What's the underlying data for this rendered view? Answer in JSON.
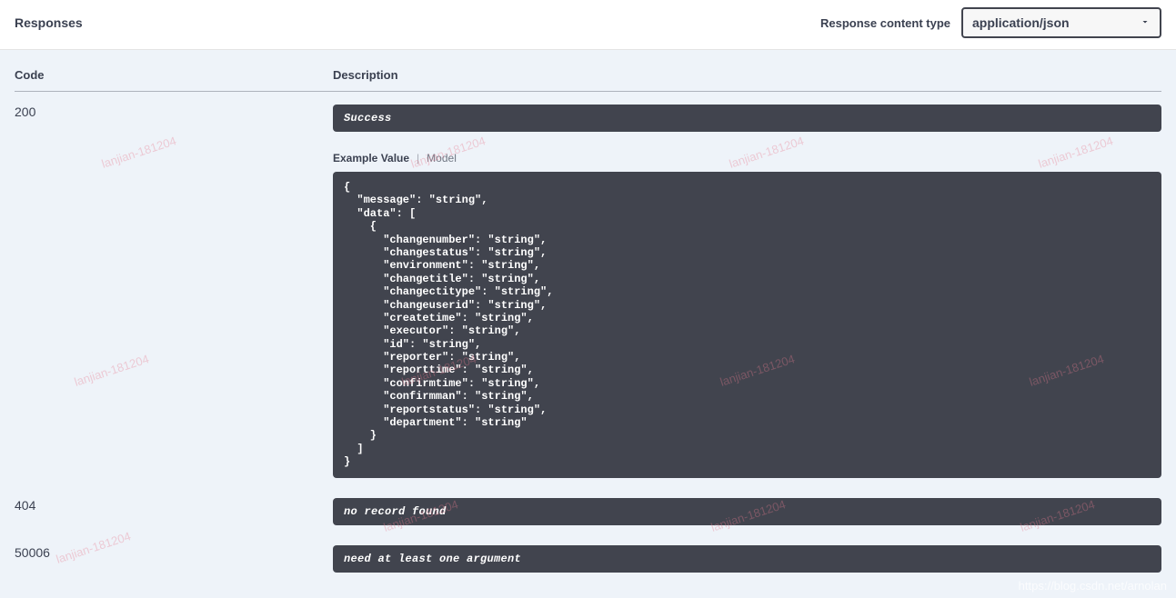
{
  "header": {
    "title": "Responses",
    "content_type_label": "Response content type",
    "content_type_value": "application/json"
  },
  "columns": {
    "code": "Code",
    "description": "Description"
  },
  "tabs": {
    "example_value": "Example Value",
    "model": "Model"
  },
  "responses": [
    {
      "code": "200",
      "description": "Success",
      "has_example": true,
      "example": "{\n  \"message\": \"string\",\n  \"data\": [\n    {\n      \"changenumber\": \"string\",\n      \"changestatus\": \"string\",\n      \"environment\": \"string\",\n      \"changetitle\": \"string\",\n      \"changectitype\": \"string\",\n      \"changeuserid\": \"string\",\n      \"createtime\": \"string\",\n      \"executor\": \"string\",\n      \"id\": \"string\",\n      \"reporter\": \"string\",\n      \"reporttime\": \"string\",\n      \"confirmtime\": \"string\",\n      \"confirmman\": \"string\",\n      \"reportstatus\": \"string\",\n      \"department\": \"string\"\n    }\n  ]\n}"
    },
    {
      "code": "404",
      "description": "no record found",
      "has_example": false
    },
    {
      "code": "50006",
      "description": "need at least one argument",
      "has_example": false
    }
  ],
  "watermark_text": "lanjian-181204",
  "footer_url": "https://blog.csdn.net/arnolan"
}
